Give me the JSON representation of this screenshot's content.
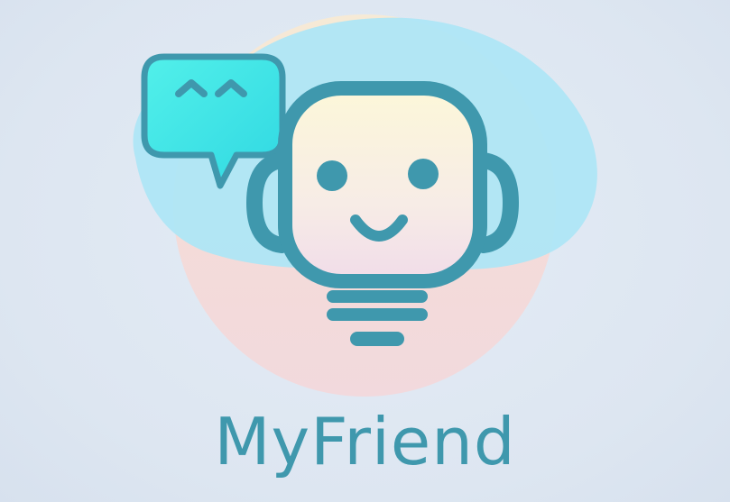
{
  "app": {
    "name": "MyFriend"
  },
  "logo": {
    "icons": [
      "robot-head-icon",
      "speech-bubble-icon",
      "lightbulb-base-icon"
    ],
    "colors": {
      "primary_teal": "#3f98ad",
      "bubble_cyan": "#3fe6e8",
      "cloud_blue": "#aee6f6",
      "blush_peach": "#f4d9d8",
      "face_cream": "#fbf4df",
      "background": "#dfe8f3"
    }
  }
}
